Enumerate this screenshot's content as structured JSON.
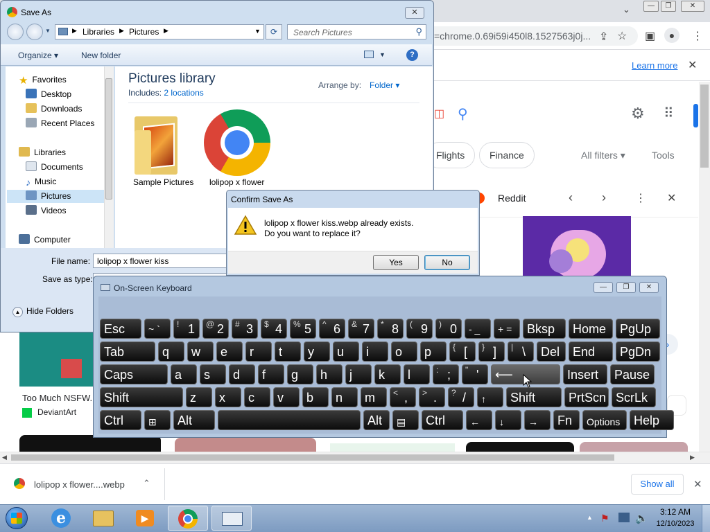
{
  "chrome": {
    "url": "=chrome.0.69i59i450l8.1527563j0j...",
    "learn_more": "Learn more",
    "chips": [
      "Flights",
      "Finance"
    ],
    "all_filters": "All filters",
    "tools": "Tools",
    "reddit_label": "Reddit",
    "result_title": "Too Much NSFW...",
    "result_source": "DeviantArt",
    "download_filename": "lolipop x flower....webp",
    "show_all": "Show all"
  },
  "save_as": {
    "title": "Save As",
    "breadcrumb": [
      "Libraries",
      "Pictures"
    ],
    "search_placeholder": "Search Pictures",
    "organize": "Organize",
    "new_folder": "New folder",
    "help": "?",
    "nav": {
      "favorites": "Favorites",
      "desktop": "Desktop",
      "downloads": "Downloads",
      "recent_places": "Recent Places",
      "libraries": "Libraries",
      "documents": "Documents",
      "music": "Music",
      "pictures": "Pictures",
      "videos": "Videos",
      "computer": "Computer"
    },
    "library_title": "Pictures library",
    "includes_label": "Includes:",
    "includes_link": "2 locations",
    "arrange_by_label": "Arrange by:",
    "arrange_by_value": "Folder",
    "files": [
      {
        "name": "Sample Pictures"
      },
      {
        "name": "lolipop x flower"
      }
    ],
    "file_name_label": "File name:",
    "file_name_value": "lolipop x flower kiss",
    "save_as_type_label": "Save as type:",
    "hide_folders": "Hide Folders"
  },
  "confirm": {
    "title": "Confirm Save As",
    "line1": "lolipop x flower kiss.webp already exists.",
    "line2": "Do you want to replace it?",
    "yes": "Yes",
    "no": "No"
  },
  "osk": {
    "title": "On-Screen Keyboard",
    "rows": [
      [
        {
          "m": "Esc",
          "s": "",
          "w": 60
        },
        {
          "m": "",
          "s": "~ `",
          "w": 38
        },
        {
          "m": "1",
          "s": "!",
          "w": 38
        },
        {
          "m": "2",
          "s": "@",
          "w": 38
        },
        {
          "m": "3",
          "s": "#",
          "w": 38
        },
        {
          "m": "4",
          "s": "$",
          "w": 38
        },
        {
          "m": "5",
          "s": "%",
          "w": 38
        },
        {
          "m": "6",
          "s": "^",
          "w": 38
        },
        {
          "m": "7",
          "s": "&",
          "w": 38
        },
        {
          "m": "8",
          "s": "*",
          "w": 38
        },
        {
          "m": "9",
          "s": "(",
          "w": 38
        },
        {
          "m": "0",
          "s": ")",
          "w": 38
        },
        {
          "m": "",
          "s": "- _",
          "w": 38
        },
        {
          "m": "",
          "s": "+ =",
          "w": 38
        },
        {
          "m": "Bksp",
          "s": "",
          "w": 62
        },
        {
          "m": "Home",
          "s": "",
          "w": 64
        },
        {
          "m": "PgUp",
          "s": "",
          "w": 64
        }
      ],
      [
        {
          "m": "Tab",
          "s": "",
          "w": 80
        },
        {
          "m": "q",
          "s": "",
          "w": 38
        },
        {
          "m": "w",
          "s": "",
          "w": 38
        },
        {
          "m": "e",
          "s": "",
          "w": 38
        },
        {
          "m": "r",
          "s": "",
          "w": 38
        },
        {
          "m": "t",
          "s": "",
          "w": 38
        },
        {
          "m": "y",
          "s": "",
          "w": 38
        },
        {
          "m": "u",
          "s": "",
          "w": 38
        },
        {
          "m": "i",
          "s": "",
          "w": 38
        },
        {
          "m": "o",
          "s": "",
          "w": 38
        },
        {
          "m": "p",
          "s": "",
          "w": 38
        },
        {
          "m": "[",
          "s": "{",
          "w": 38
        },
        {
          "m": "]",
          "s": "}",
          "w": 38
        },
        {
          "m": "\\",
          "s": "|",
          "w": 38
        },
        {
          "m": "Del",
          "s": "",
          "w": 42
        },
        {
          "m": "End",
          "s": "",
          "w": 64
        },
        {
          "m": "PgDn",
          "s": "",
          "w": 64
        }
      ],
      [
        {
          "m": "Caps",
          "s": "",
          "w": 98
        },
        {
          "m": "a",
          "s": "",
          "w": 38
        },
        {
          "m": "s",
          "s": "",
          "w": 38
        },
        {
          "m": "d",
          "s": "",
          "w": 38
        },
        {
          "m": "f",
          "s": "",
          "w": 38
        },
        {
          "m": "g",
          "s": "",
          "w": 38
        },
        {
          "m": "h",
          "s": "",
          "w": 38
        },
        {
          "m": "j",
          "s": "",
          "w": 38
        },
        {
          "m": "k",
          "s": "",
          "w": 38
        },
        {
          "m": "l",
          "s": "",
          "w": 38
        },
        {
          "m": ";",
          "s": ":",
          "w": 38
        },
        {
          "m": "'",
          "s": "\"",
          "w": 38
        },
        {
          "m": "⟵",
          "s": "",
          "w": 100,
          "grey": true
        },
        {
          "m": "Insert",
          "s": "",
          "w": 64
        },
        {
          "m": "Pause",
          "s": "",
          "w": 64
        }
      ],
      [
        {
          "m": "Shift",
          "s": "",
          "w": 120
        },
        {
          "m": "z",
          "s": "",
          "w": 38
        },
        {
          "m": "x",
          "s": "",
          "w": 38
        },
        {
          "m": "c",
          "s": "",
          "w": 38
        },
        {
          "m": "v",
          "s": "",
          "w": 38
        },
        {
          "m": "b",
          "s": "",
          "w": 38
        },
        {
          "m": "n",
          "s": "",
          "w": 38
        },
        {
          "m": "m",
          "s": "",
          "w": 38
        },
        {
          "m": ",",
          "s": "<",
          "w": 38
        },
        {
          "m": ".",
          "s": ">",
          "w": 38
        },
        {
          "m": "/",
          "s": "?",
          "w": 38
        },
        {
          "m": "↑",
          "s": "",
          "w": 38,
          "small": true
        },
        {
          "m": "Shift",
          "s": "",
          "w": 80
        },
        {
          "m": "PrtScn",
          "s": "",
          "w": 64
        },
        {
          "m": "ScrLk",
          "s": "",
          "w": 64
        }
      ],
      [
        {
          "m": "Ctrl",
          "s": "",
          "w": 60
        },
        {
          "m": "⊞",
          "s": "",
          "w": 38,
          "small": true
        },
        {
          "m": "Alt",
          "s": "",
          "w": 60
        },
        {
          "m": "",
          "s": "",
          "w": 206
        },
        {
          "m": "Alt",
          "s": "",
          "w": 38
        },
        {
          "m": "▤",
          "s": "",
          "w": 38,
          "small": true
        },
        {
          "m": "Ctrl",
          "s": "",
          "w": 60
        },
        {
          "m": "←",
          "s": "",
          "w": 38,
          "small": true
        },
        {
          "m": "↓",
          "s": "",
          "w": 38,
          "small": true
        },
        {
          "m": "→",
          "s": "",
          "w": 38,
          "small": true
        },
        {
          "m": "Fn",
          "s": "",
          "w": 38
        },
        {
          "m": "Options",
          "s": "",
          "w": 64,
          "small": true
        },
        {
          "m": "Help",
          "s": "",
          "w": 64
        }
      ]
    ]
  },
  "taskbar": {
    "time": "3:12 AM",
    "date": "12/10/2023"
  }
}
